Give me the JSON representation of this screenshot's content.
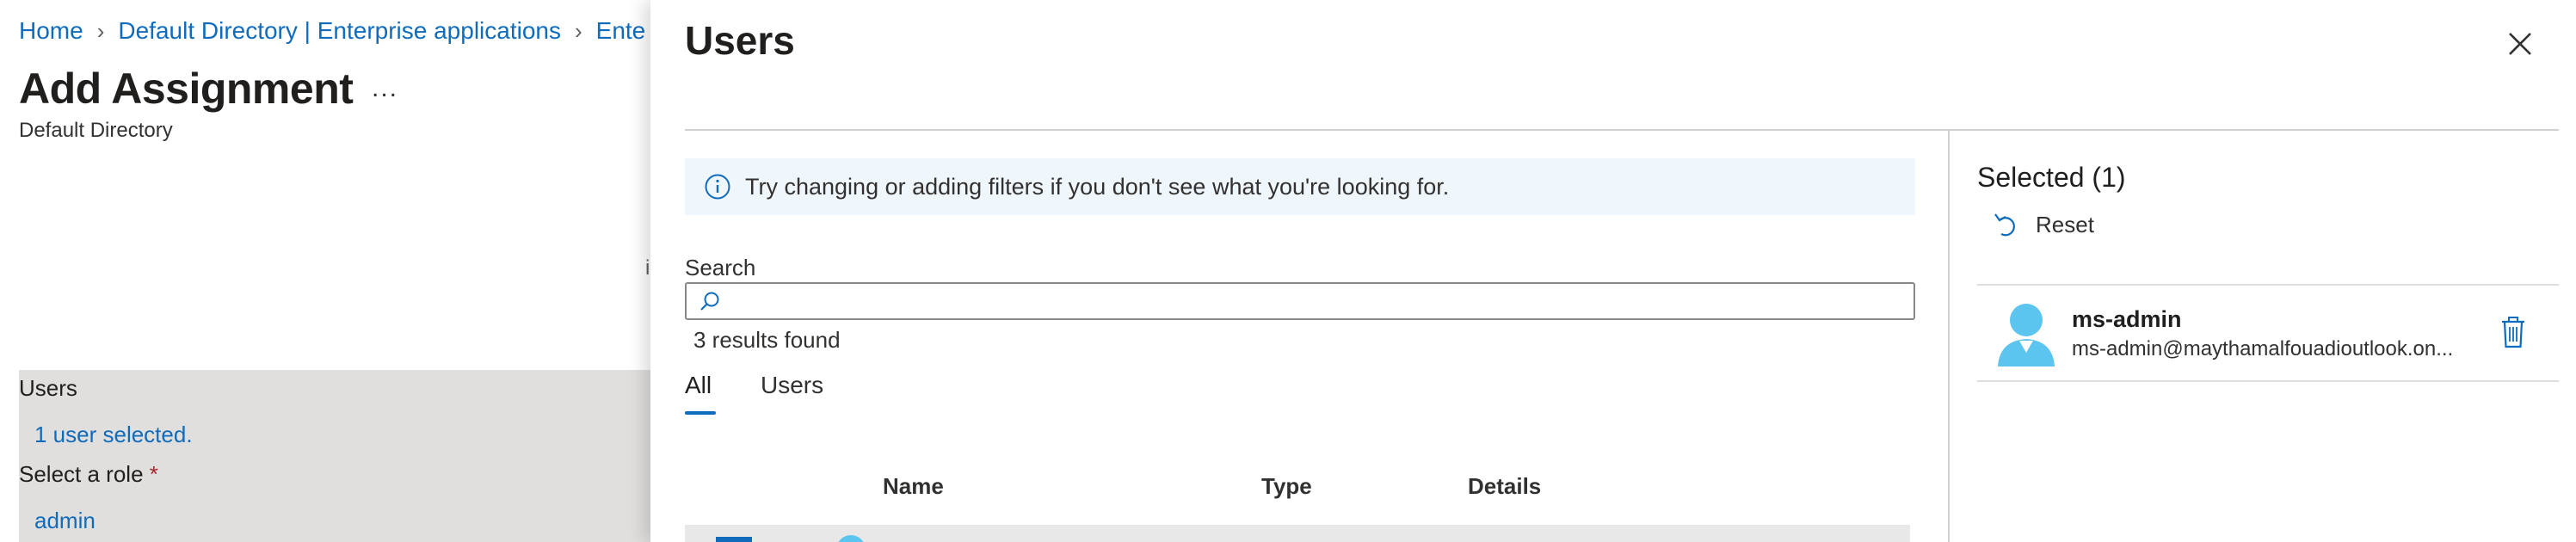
{
  "breadcrumb": {
    "items": [
      "Home",
      "Default Directory | Enterprise applications",
      "Ente"
    ]
  },
  "page": {
    "title": "Add Assignment",
    "more_label": "...",
    "subtitle": "Default Directory",
    "fragment": "i"
  },
  "form": {
    "users_label": "Users",
    "users_value": "1 user selected.",
    "role_label": "Select a role",
    "role_required": "*",
    "role_value": "admin"
  },
  "panel": {
    "title": "Users",
    "info_text": "Try changing or adding filters if you don't see what you're looking for.",
    "search_label": "Search",
    "search_value": "",
    "results_text": "3 results found",
    "tabs": [
      {
        "label": "All",
        "active": true
      },
      {
        "label": "Users",
        "active": false
      }
    ],
    "columns": [
      "Name",
      "Type",
      "Details"
    ]
  },
  "selected": {
    "title": "Selected (1)",
    "reset_label": "Reset",
    "user": {
      "name": "ms-admin",
      "email": "ms-admin@maythamalfouadioutlook.on..."
    }
  },
  "icons": {
    "breadcrumb_separator": "chevron-right-icon",
    "close": "close-icon",
    "info": "info-icon",
    "search": "search-icon",
    "reset": "undo-icon",
    "avatar": "user-avatar-icon",
    "delete": "trash-icon"
  },
  "colors": {
    "link": "#0f6cbd",
    "accent": "#0f6cbd",
    "info_bg": "#eff6fc",
    "avatar": "#5bc4ef",
    "form_bg": "#e1dfdd",
    "required": "#a4262c"
  }
}
